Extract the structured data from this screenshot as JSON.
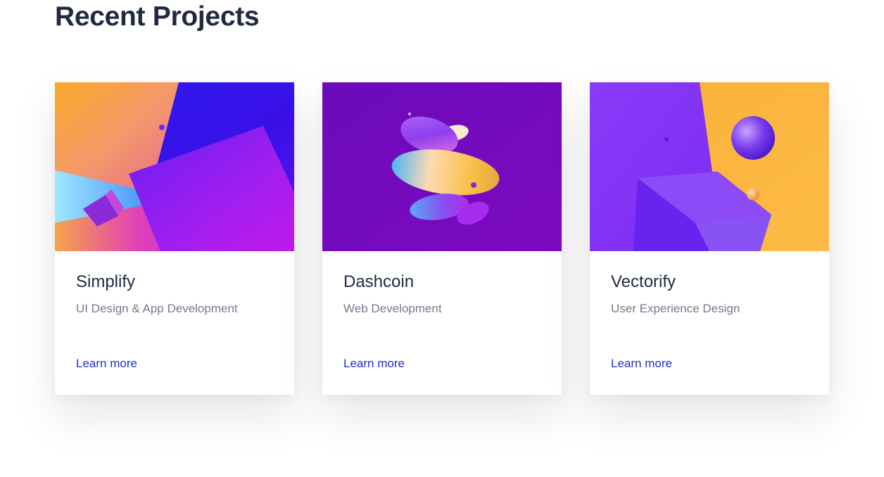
{
  "section": {
    "title": "Recent Projects"
  },
  "projects": [
    {
      "title": "Simplify",
      "subtitle": "UI Design & App Development",
      "link_label": "Learn more",
      "artwork": "abstract-gradient-shapes"
    },
    {
      "title": "Dashcoin",
      "subtitle": "Web Development",
      "link_label": "Learn more",
      "artwork": "floating-discs"
    },
    {
      "title": "Vectorify",
      "subtitle": "User Experience Design",
      "link_label": "Learn more",
      "artwork": "cube-and-spheres"
    }
  ],
  "colors": {
    "heading": "#222a41",
    "muted_text": "#737a8c",
    "link": "#1b2fd0"
  }
}
